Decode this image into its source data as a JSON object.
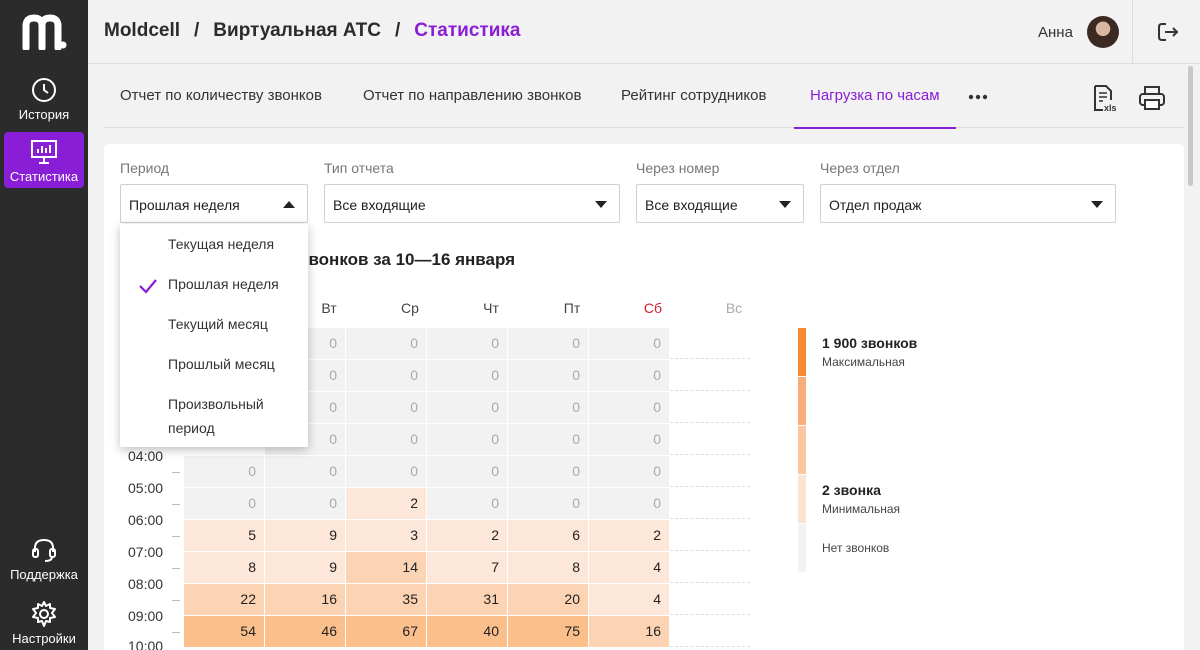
{
  "brand": {
    "logo": "m",
    "accent": "#8a1ed6"
  },
  "sidebar": {
    "items": [
      {
        "label": "История",
        "icon": "clock-icon"
      },
      {
        "label": "Статистика",
        "icon": "chart-icon"
      },
      {
        "label": "Поддержка",
        "icon": "headset-icon"
      },
      {
        "label": "Настройки",
        "icon": "gear-icon"
      }
    ]
  },
  "header": {
    "breadcrumb": [
      "Moldcell",
      "Виртуальная АТС",
      "Статистика"
    ],
    "sep": "/",
    "user": "Анна"
  },
  "tabs": [
    "Отчет по количеству звонков",
    "Отчет по направлению звонков",
    "Рейтинг сотрудников",
    "Нагрузка по часам"
  ],
  "filters": [
    {
      "label": "Период",
      "value": "Прошлая неделя"
    },
    {
      "label": "Тип отчета",
      "value": "Все входящие"
    },
    {
      "label": "Через номер",
      "value": "Все входящие"
    },
    {
      "label": "Через отдел",
      "value": "Отдел продаж"
    }
  ],
  "dropdown": {
    "options": [
      "Текущая неделя",
      "Прошлая неделя",
      "Текущий месяц",
      "Прошлый месяц",
      "Произвольный период"
    ],
    "selected": "Прошлая неделя"
  },
  "report": {
    "title": "звонков за 10—16 января",
    "days": [
      "Вт",
      "Ср",
      "Чт",
      "Пт",
      "Сб",
      "Вс"
    ],
    "hours": [
      "04:00",
      "05:00",
      "06:00",
      "07:00",
      "08:00",
      "09:00",
      "10:00"
    ],
    "rows": [
      {
        "cells": [
          "0",
          "0",
          "0",
          "0",
          "0"
        ],
        "levels": [
          "z",
          "z",
          "z",
          "z",
          "z"
        ]
      },
      {
        "cells": [
          "0",
          "0",
          "0",
          "0",
          "0"
        ],
        "levels": [
          "z",
          "z",
          "z",
          "z",
          "z"
        ]
      },
      {
        "cells": [
          "",
          "0",
          "0",
          "0",
          "0",
          "0"
        ],
        "levels": [
          "z",
          "z",
          "z",
          "z",
          "z",
          "z"
        ]
      },
      {
        "cells": [
          "",
          "0",
          "0",
          "0",
          "0",
          "0"
        ],
        "levels": [
          "z",
          "z",
          "z",
          "z",
          "z",
          "z"
        ]
      },
      {
        "cells": [
          "0",
          "0",
          "0",
          "0",
          "0",
          "0"
        ],
        "levels": [
          "z",
          "z",
          "z",
          "z",
          "z",
          "z"
        ]
      },
      {
        "cells": [
          "0",
          "0",
          "2",
          "0",
          "0",
          "0"
        ],
        "levels": [
          "z",
          "z",
          "l1",
          "z",
          "z",
          "z"
        ]
      },
      {
        "cells": [
          "5",
          "9",
          "3",
          "2",
          "6",
          "2"
        ],
        "levels": [
          "l1",
          "l1",
          "l1",
          "l1",
          "l1",
          "l1"
        ]
      },
      {
        "cells": [
          "8",
          "9",
          "14",
          "7",
          "8",
          "4"
        ],
        "levels": [
          "l1",
          "l1",
          "l2",
          "l1",
          "l1",
          "l1"
        ]
      },
      {
        "cells": [
          "22",
          "16",
          "35",
          "31",
          "20",
          "4"
        ],
        "levels": [
          "l2",
          "l2",
          "l2",
          "l2",
          "l2",
          "l1"
        ]
      },
      {
        "cells": [
          "54",
          "46",
          "67",
          "40",
          "75",
          "16"
        ],
        "levels": [
          "l3",
          "l3",
          "l3",
          "l3",
          "l3",
          "l2"
        ]
      }
    ]
  },
  "legend": {
    "max_title": "1 900 звонков",
    "max_sub": "Максимальная",
    "min_title": "2 звонка",
    "min_sub": "Минимальная",
    "none": "Нет звонков",
    "colors": [
      "#f58a35",
      "#f9ad77",
      "#fcc7a0",
      "#fde3d2",
      "#f2f2f2"
    ]
  }
}
